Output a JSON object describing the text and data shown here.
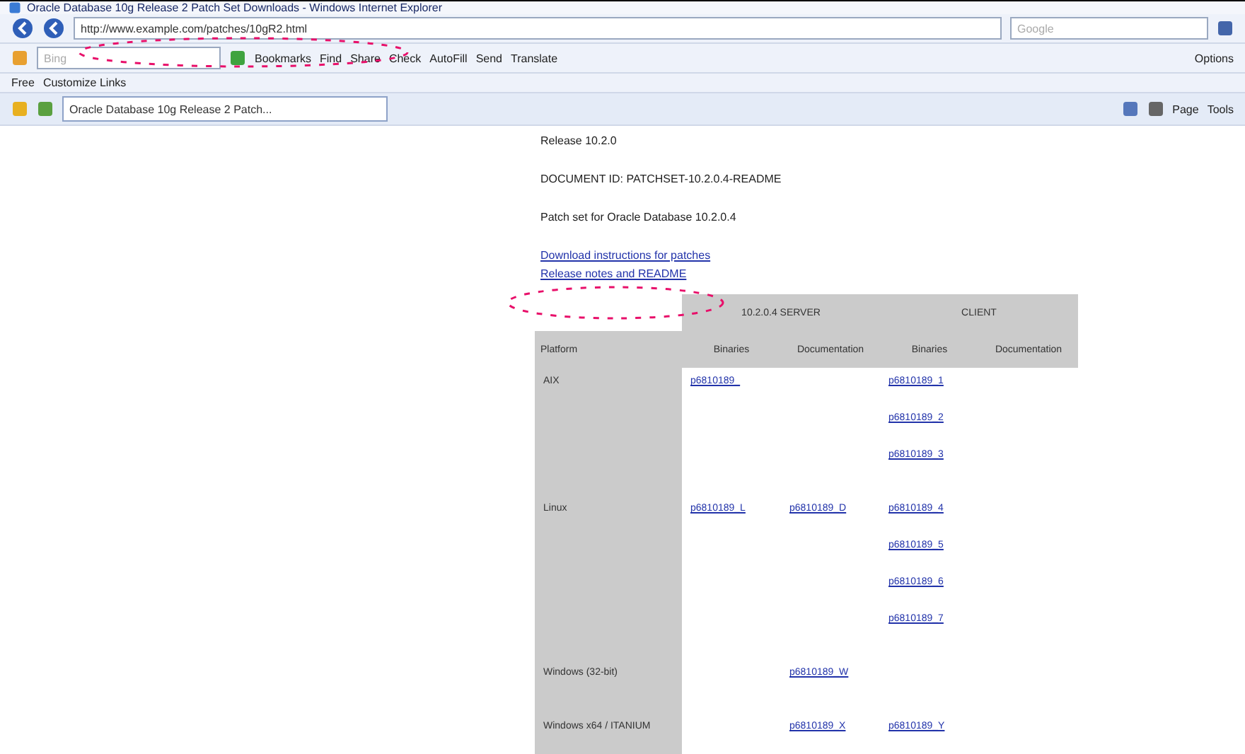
{
  "window": {
    "title": "Oracle Database 10g Release 2 Patch Set Downloads - Windows Internet Explorer"
  },
  "address_bar": {
    "url": "http://www.example.com/patches/10gR2.html",
    "search_placeholder": "Google"
  },
  "toolbar": {
    "search_placeholder": "Bing",
    "items": [
      "Bookmarks",
      "Find",
      "Share",
      "Check",
      "AutoFill",
      "Send",
      "Translate"
    ],
    "options": "Options"
  },
  "links": [
    "Free",
    "Customize Links"
  ],
  "tab": {
    "title": "Oracle Database 10g Release 2 Patch...",
    "selected": true
  },
  "command_bar": {
    "page": "Page",
    "tools": "Tools"
  },
  "content": {
    "paragraphs": [
      "Release 10.2.0",
      "DOCUMENT ID: PATCHSET-10.2.0.4-README",
      "Patch set for Oracle Database 10.2.0.4"
    ],
    "links": [
      "Download instructions for patches",
      "Release notes and README"
    ],
    "table": {
      "groups": [
        "10.2.0.4 SERVER",
        "CLIENT"
      ],
      "columns": [
        "Platform",
        "Binaries",
        "Documentation",
        "Binaries",
        "Documentation"
      ],
      "rows": [
        {
          "cells": [
            [
              "AIX"
            ],
            [
              "p6810189_"
            ],
            [],
            [
              "p6810189_1",
              "p6810189_2",
              "p6810189_3"
            ],
            []
          ]
        },
        {
          "cells": [
            [
              "Linux"
            ],
            [
              "p6810189_L"
            ],
            [
              "p6810189_D"
            ],
            [
              "p6810189_4",
              "p6810189_5",
              "p6810189_6",
              "p6810189_7"
            ],
            []
          ]
        },
        {
          "cells": [
            [
              "Windows (32-bit)"
            ],
            [],
            [
              "p6810189_W"
            ],
            [],
            []
          ]
        },
        {
          "cells": [
            [
              "Windows x64 / ITANIUM"
            ],
            [],
            [
              "p6810189_X"
            ],
            [
              "p6810189_Y"
            ],
            []
          ]
        }
      ]
    }
  }
}
